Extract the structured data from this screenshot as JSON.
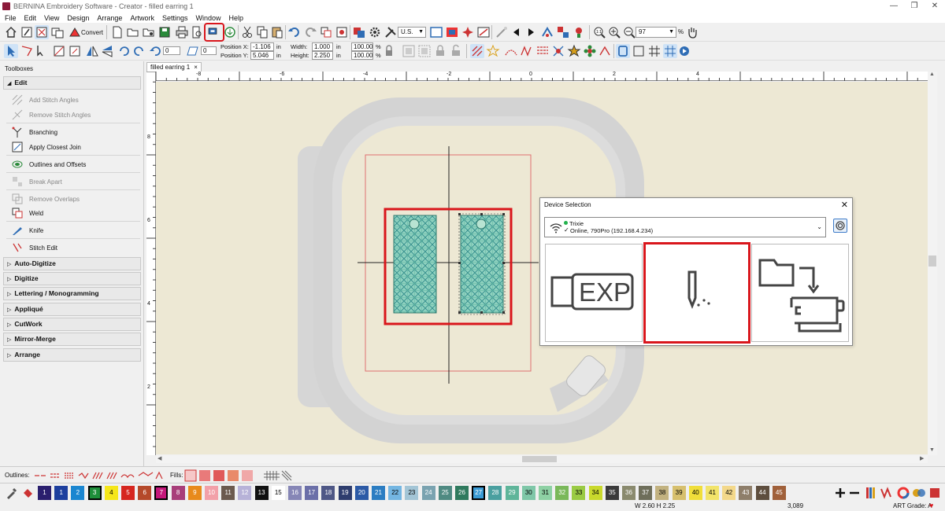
{
  "window": {
    "title": "BERNINA Embroidery Software - Creator - filled earring 1",
    "controls": [
      "—",
      "❐",
      "✕"
    ]
  },
  "menu": [
    "File",
    "Edit",
    "View",
    "Design",
    "Arrange",
    "Artwork",
    "Settings",
    "Window",
    "Help"
  ],
  "toolbar1": {
    "convert_label": "Convert",
    "units_value": "U.S.",
    "zoom_value": "97",
    "zoom_unit": "%"
  },
  "toolbar2": {
    "spin1_value": "0",
    "spin2_value": "0",
    "position_x_label": "Position X:",
    "position_y_label": "Position Y:",
    "position_x_value": "-1.106",
    "position_y_value": "5.046",
    "width_label": "Width:",
    "height_label": "Height:",
    "width_value": "1.000",
    "height_value": "2.250",
    "unit_in": "in",
    "scale_w_value": "100.00",
    "scale_h_value": "100.00",
    "pct": "%"
  },
  "leftpanel": {
    "title": "Toolboxes",
    "edit_section": "Edit",
    "tools": [
      {
        "label": "Add Stitch Angles",
        "icon": "add-stitch-angles-icon",
        "enabled": false
      },
      {
        "label": "Remove Stitch Angles",
        "icon": "remove-stitch-angles-icon",
        "enabled": false
      },
      {
        "label": "Branching",
        "icon": "branching-icon",
        "enabled": true
      },
      {
        "label": "Apply Closest Join",
        "icon": "closest-join-icon",
        "enabled": true
      },
      {
        "label": "Outlines and Offsets",
        "icon": "outlines-offsets-icon",
        "enabled": true
      },
      {
        "label": "Break Apart",
        "icon": "break-apart-icon",
        "enabled": false
      },
      {
        "label": "Remove Overlaps",
        "icon": "remove-overlaps-icon",
        "enabled": false
      },
      {
        "label": "Weld",
        "icon": "weld-icon",
        "enabled": true
      },
      {
        "label": "Knife",
        "icon": "knife-icon",
        "enabled": true
      },
      {
        "label": "Stitch Edit",
        "icon": "stitch-edit-icon",
        "enabled": true
      }
    ],
    "sections": [
      "Auto-Digitize",
      "Digitize",
      "Lettering / Monogramming",
      "Appliqué",
      "CutWork",
      "Mirror-Merge",
      "Arrange"
    ]
  },
  "document": {
    "tab_label": "filled earring 1",
    "tab_close": "×"
  },
  "rulers": {
    "h_labels": [
      "-8",
      "-6",
      "-4",
      "-2",
      "0",
      "2",
      "4"
    ],
    "v_labels": [
      "8",
      "6",
      "4",
      "2"
    ]
  },
  "dialog": {
    "title": "Device Selection",
    "close": "✕",
    "device_name": "Trixie",
    "device_status": "Online, 790Pro (192.168.4.234)",
    "combo_arrow": "⌄",
    "exp_label": "EXP",
    "status_color": "#22b14c"
  },
  "outlines_bar": {
    "outlines_label": "Outlines:",
    "fills_label": "Fills:"
  },
  "colors": {
    "swatches": [
      {
        "n": "1",
        "c": "#2a1f6e",
        "fg": "#fff"
      },
      {
        "n": "1",
        "c": "#1d3f9e",
        "fg": "#fff"
      },
      {
        "n": "2",
        "c": "#1a86d0",
        "fg": "#fff"
      },
      {
        "n": "3",
        "c": "#1e8f3a",
        "fg": "#fff",
        "sel": true
      },
      {
        "n": "4",
        "c": "#f5e61a",
        "fg": "#000"
      },
      {
        "n": "5",
        "c": "#d6261f",
        "fg": "#fff"
      },
      {
        "n": "6",
        "c": "#b5492a",
        "fg": "#fff"
      },
      {
        "n": "7",
        "c": "#c4177a",
        "fg": "#fff",
        "sel": true
      },
      {
        "n": "8",
        "c": "#a83e7a",
        "fg": "#fff"
      },
      {
        "n": "9",
        "c": "#e88a1c",
        "fg": "#fff"
      },
      {
        "n": "10",
        "c": "#f2a0a8",
        "fg": "#fff"
      },
      {
        "n": "11",
        "c": "#6b5a4e",
        "fg": "#fff"
      },
      {
        "n": "12",
        "c": "#b7b2d8",
        "fg": "#fff"
      },
      {
        "n": "13",
        "c": "#111111",
        "fg": "#fff"
      },
      {
        "n": "15",
        "c": "#ffffff",
        "fg": "#000"
      },
      {
        "n": "16",
        "c": "#8686b6",
        "fg": "#fff"
      },
      {
        "n": "17",
        "c": "#6b6fa8",
        "fg": "#fff"
      },
      {
        "n": "18",
        "c": "#4e5786",
        "fg": "#fff"
      },
      {
        "n": "19",
        "c": "#2e3d6e",
        "fg": "#fff"
      },
      {
        "n": "20",
        "c": "#2c5aa6",
        "fg": "#fff"
      },
      {
        "n": "21",
        "c": "#2b7dc2",
        "fg": "#fff"
      },
      {
        "n": "22",
        "c": "#74b6e2",
        "fg": "#000"
      },
      {
        "n": "23",
        "c": "#a3c5d6",
        "fg": "#000"
      },
      {
        "n": "24",
        "c": "#7aa3b0",
        "fg": "#fff"
      },
      {
        "n": "25",
        "c": "#4f8a82",
        "fg": "#fff"
      },
      {
        "n": "26",
        "c": "#2f7a5e",
        "fg": "#fff"
      },
      {
        "n": "27",
        "c": "#3a9bd5",
        "fg": "#fff",
        "sel": true
      },
      {
        "n": "28",
        "c": "#4aa0a0",
        "fg": "#fff"
      },
      {
        "n": "29",
        "c": "#5fb59a",
        "fg": "#fff"
      },
      {
        "n": "30",
        "c": "#7fc7a8",
        "fg": "#000"
      },
      {
        "n": "31",
        "c": "#8ed1a4",
        "fg": "#000"
      },
      {
        "n": "32",
        "c": "#7ab85a",
        "fg": "#fff"
      },
      {
        "n": "33",
        "c": "#9acb44",
        "fg": "#000"
      },
      {
        "n": "34",
        "c": "#c9d92c",
        "fg": "#000"
      },
      {
        "n": "35",
        "c": "#3b3b3b",
        "fg": "#fff"
      },
      {
        "n": "36",
        "c": "#8a8a6e",
        "fg": "#fff"
      },
      {
        "n": "37",
        "c": "#6e6e5a",
        "fg": "#fff"
      },
      {
        "n": "38",
        "c": "#c2b280",
        "fg": "#000"
      },
      {
        "n": "39",
        "c": "#d7c06e",
        "fg": "#000"
      },
      {
        "n": "40",
        "c": "#f0de3a",
        "fg": "#000"
      },
      {
        "n": "41",
        "c": "#f2e46a",
        "fg": "#000"
      },
      {
        "n": "42",
        "c": "#f3d88a",
        "fg": "#000"
      },
      {
        "n": "43",
        "c": "#8e7e6a",
        "fg": "#fff"
      },
      {
        "n": "44",
        "c": "#5e4e3e",
        "fg": "#fff"
      },
      {
        "n": "45",
        "c": "#a0603a",
        "fg": "#fff"
      }
    ]
  },
  "status": {
    "dimensions": "W 2.60 H 2.25",
    "stitch_count": "3,089",
    "art_grade": "ART Grade: A"
  }
}
